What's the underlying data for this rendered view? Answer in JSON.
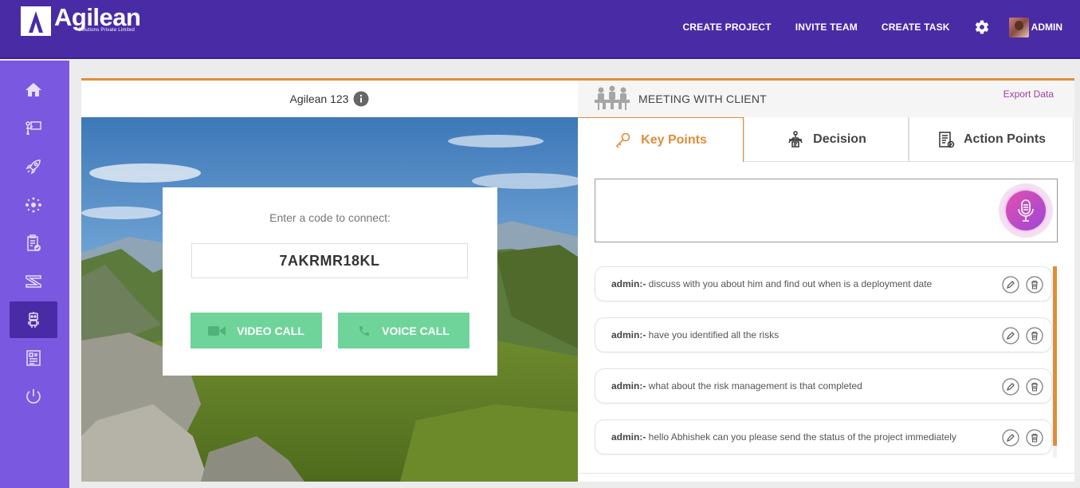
{
  "brand": {
    "name": "Agilean",
    "tagline": "Solutions Private Limited",
    "colors": {
      "header": "#4a2ba6",
      "sidebar": "#7b58e0",
      "accent": "#e08c39",
      "button": "#6fd49a"
    }
  },
  "topnav": {
    "items": [
      "CREATE PROJECT",
      "INVITE TEAM",
      "CREATE TASK"
    ],
    "settings_icon": "gear-icon",
    "user_label": "ADMIN"
  },
  "sidebar": {
    "items": [
      {
        "icon": "home-icon"
      },
      {
        "icon": "presentation-icon"
      },
      {
        "icon": "rocket-icon"
      },
      {
        "icon": "network-icon"
      },
      {
        "icon": "clipboard-check-icon"
      },
      {
        "icon": "sprint-icon"
      },
      {
        "icon": "robot-icon",
        "active": true
      },
      {
        "icon": "newspaper-icon"
      },
      {
        "icon": "power-icon"
      }
    ]
  },
  "room": {
    "title": "Agilean 123",
    "connect_prompt": "Enter a code to connect:",
    "code": "7AKRMR18KL",
    "video_label": "VIDEO CALL",
    "voice_label": "VOICE CALL"
  },
  "meeting": {
    "title": "MEETING WITH CLIENT",
    "export_label": "Export Data",
    "tabs": [
      "Key Points",
      "Decision",
      "Action Points"
    ],
    "active_tab": "Key Points",
    "input_value": "",
    "notes": [
      {
        "author": "admin:-",
        "text": " discuss with you about him and find out when is a deployment date"
      },
      {
        "author": "admin:-",
        "text": " have you identified all the risks"
      },
      {
        "author": "admin:-",
        "text": " what about the risk management is that completed"
      },
      {
        "author": "admin:-",
        "text": " hello Abhishek can you please send the status of the project immediately"
      }
    ]
  }
}
